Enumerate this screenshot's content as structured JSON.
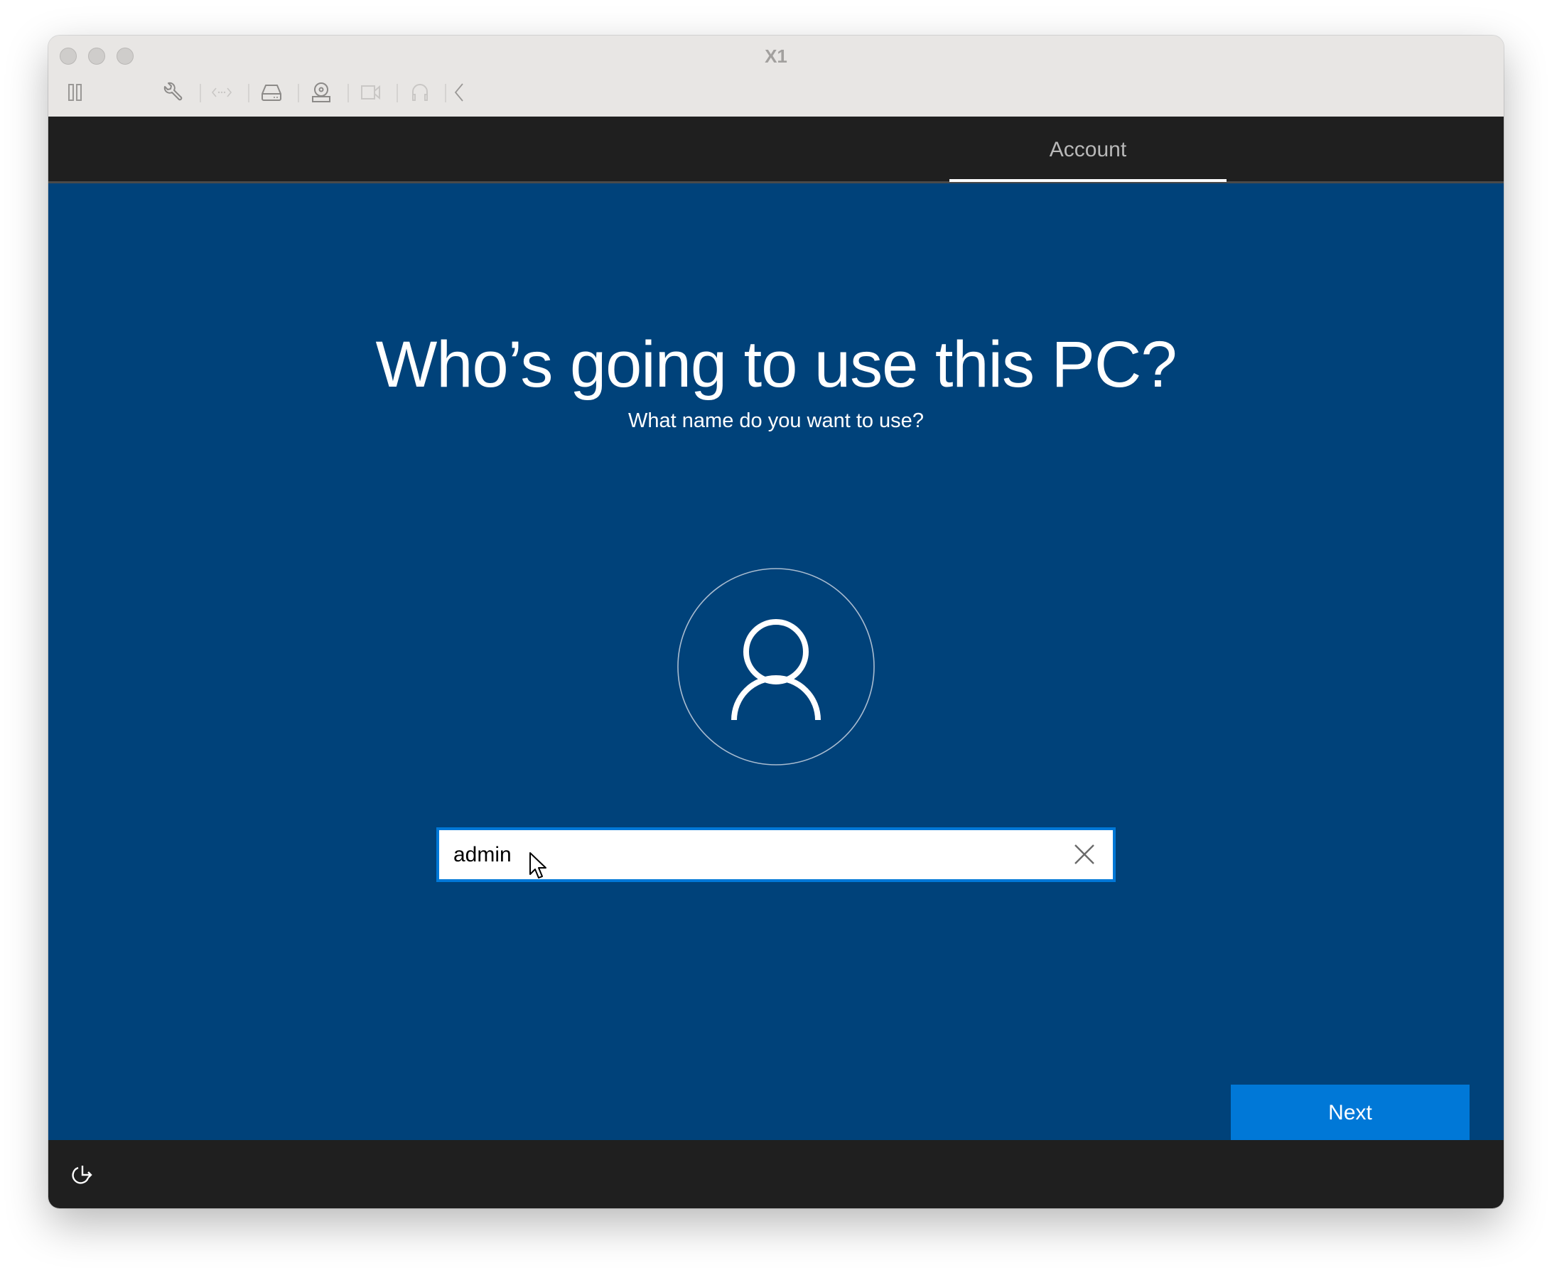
{
  "window": {
    "title": "X1",
    "traffic_lights": [
      "close",
      "minimize",
      "zoom"
    ]
  },
  "toolbar": {
    "icons": [
      {
        "name": "pause-icon",
        "label": "Pause"
      },
      {
        "name": "wrench-icon",
        "label": "Settings"
      },
      {
        "name": "network-icon",
        "label": "Network"
      },
      {
        "name": "hard-drive-icon",
        "label": "Disk"
      },
      {
        "name": "optical-drive-icon",
        "label": "Optical drive"
      },
      {
        "name": "camera-icon",
        "label": "Camera"
      },
      {
        "name": "headphones-icon",
        "label": "Audio"
      },
      {
        "name": "chevron-left-icon",
        "label": "Collapse"
      }
    ]
  },
  "header": {
    "tabs": [
      {
        "label": "Account",
        "active": true
      }
    ]
  },
  "main": {
    "title": "Who’s going to use this PC?",
    "subtitle": "What name do you want to use?",
    "avatar_icon": "user-icon",
    "name_field": {
      "value": "admin",
      "placeholder": "",
      "clear_icon": "close-icon"
    },
    "next_label": "Next"
  },
  "footer": {
    "ease_of_access_icon": "ease-of-access-icon"
  },
  "colors": {
    "content_background": "#00427a",
    "bar_background": "#1f1f1f",
    "accent": "#0078d7",
    "titlebar_background": "#e8e6e4"
  }
}
